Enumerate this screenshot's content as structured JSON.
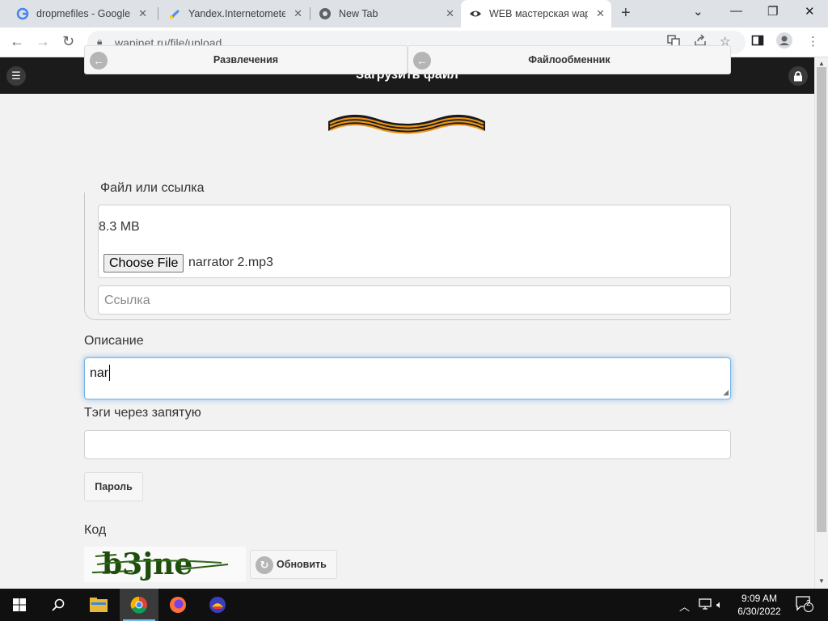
{
  "browser": {
    "tabs": [
      {
        "title": "dropmefiles - Google S",
        "icon": "google-icon"
      },
      {
        "title": "Yandex.Internetometer",
        "icon": "yandex-icon"
      },
      {
        "title": "New Tab",
        "icon": "chrome-icon"
      },
      {
        "title": "WEB мастерская wapi",
        "icon": "wapinet-icon",
        "active": true
      }
    ],
    "url": "wapinet.ru/file/upload"
  },
  "header": {
    "title": "Загрузить файл"
  },
  "nav": {
    "left": "Развлечения",
    "right": "Файлообменник"
  },
  "form": {
    "file_legend": "Файл или ссылка",
    "file_size": "8.3 MB",
    "choose_label": "Choose File",
    "file_name": "narrator 2.mp3",
    "link_placeholder": "Ссылка",
    "desc_label": "Описание",
    "desc_value": "nar",
    "tags_label": "Тэги через запятую",
    "password_label": "Пароль",
    "code_label": "Код",
    "captcha_text": "b3jne",
    "refresh_label": "Обновить"
  },
  "taskbar": {
    "time": "9:09 AM",
    "date": "6/30/2022",
    "notifications": "2"
  },
  "colors": {
    "header_bg": "#1b1b1b",
    "focus": "#7ab0e0"
  }
}
